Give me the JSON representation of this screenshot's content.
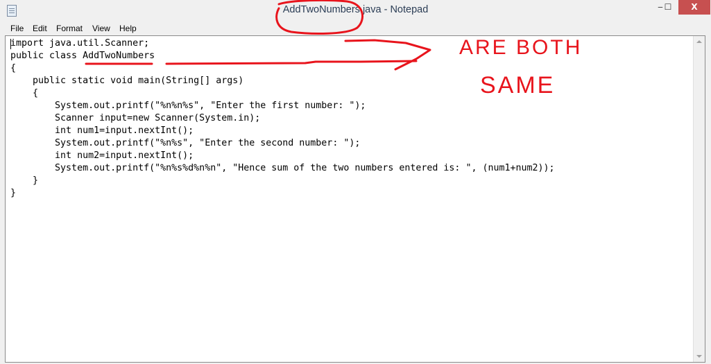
{
  "window": {
    "title": "AddTwoNumbers.java - Notepad",
    "minimize": "‒",
    "maximize": "☐",
    "close": "X"
  },
  "menu": [
    "File",
    "Edit",
    "Format",
    "View",
    "Help"
  ],
  "editor": {
    "lines": [
      "import java.util.Scanner;",
      "public class AddTwoNumbers",
      "{",
      "    public static void main(String[] args)",
      "    {",
      "        System.out.printf(\"%n%n%s\", \"Enter the first number: \");",
      "        Scanner input=new Scanner(System.in);",
      "        int num1=input.nextInt();",
      "        System.out.printf(\"%n%s\", \"Enter the second number: \");",
      "        int num2=input.nextInt();",
      "        System.out.printf(\"%n%s%d%n%n\", \"Hence sum of the two numbers entered is: \", (num1+num2));",
      "    }",
      "}"
    ]
  },
  "annotation": {
    "line1": "ARE BOTH",
    "line2": "SAME",
    "color": "#e8141c"
  }
}
